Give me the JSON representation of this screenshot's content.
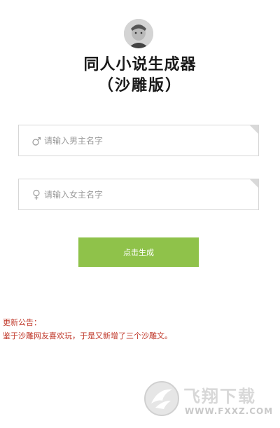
{
  "header": {
    "title": "同人小说生成器",
    "subtitle": "（沙雕版）"
  },
  "form": {
    "male_placeholder": "请输入男主名字",
    "female_placeholder": "请输入女主名字",
    "generate_label": "点击生成",
    "accent_color": "#8fc24a"
  },
  "notice": {
    "title": "更新公告：",
    "text": "鉴于沙雕网友喜欢玩，于是又新增了三个沙雕文。",
    "color": "#c0392b"
  },
  "watermark": {
    "name": "飞翔下载",
    "url": "WWW.FXXZ.COM"
  },
  "icons": {
    "avatar": "avatar",
    "male": "male-symbol-icon",
    "female": "female-symbol-icon",
    "watermark_logo": "fxxz-logo"
  }
}
